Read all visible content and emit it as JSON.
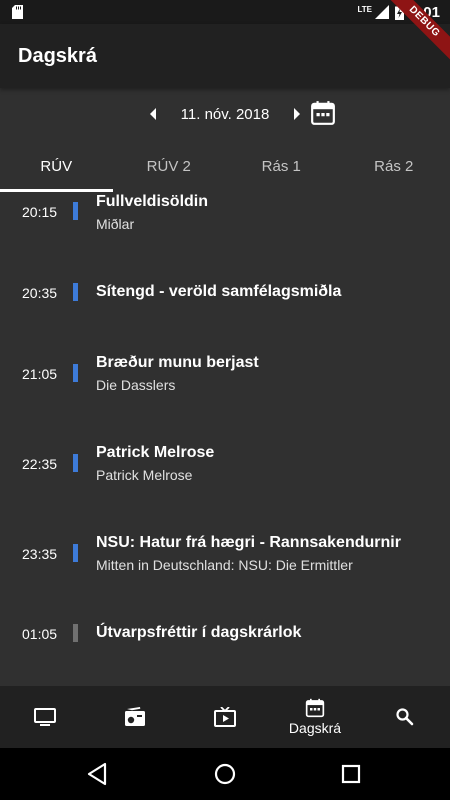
{
  "status": {
    "time": "5:01",
    "network": "LTE",
    "debug_label": "DEBUG"
  },
  "app": {
    "title": "Dagskrá"
  },
  "date": {
    "label": "11. nóv. 2018"
  },
  "tabs": [
    {
      "label": "RÚV",
      "active": true
    },
    {
      "label": "RÚV 2",
      "active": false
    },
    {
      "label": "Rás 1",
      "active": false
    },
    {
      "label": "Rás 2",
      "active": false
    }
  ],
  "schedule": [
    {
      "time": "20:15",
      "title": "Fullveldisöldin",
      "subtitle": "Miðlar",
      "bar_color": "#3d7bd9"
    },
    {
      "time": "20:35",
      "title": "Sítengd - veröld samfélagsmiðla",
      "subtitle": "",
      "bar_color": "#3d7bd9"
    },
    {
      "time": "21:05",
      "title": "Bræður munu berjast",
      "subtitle": "Die Dasslers",
      "bar_color": "#3d7bd9"
    },
    {
      "time": "22:35",
      "title": "Patrick Melrose",
      "subtitle": "Patrick Melrose",
      "bar_color": "#3d7bd9"
    },
    {
      "time": "23:35",
      "title": "NSU: Hatur frá hægri - Rannsakendurnir",
      "subtitle": "Mitten in Deutschland: NSU: Die Ermittler",
      "bar_color": "#3d7bd9"
    },
    {
      "time": "01:05",
      "title": "Útvarpsfréttir í dagskrárlok",
      "subtitle": "",
      "bar_color": "#707070"
    }
  ],
  "bottom_nav": {
    "schedule_label": "Dagskrá",
    "items": [
      "tv-icon",
      "radio-icon",
      "live-tv-icon",
      "calendar-icon",
      "search-icon"
    ]
  },
  "colors": {
    "accent": "#3d7bd9",
    "background": "#303030",
    "app_bar": "#212121",
    "debug_ribbon": "#8e1414"
  }
}
